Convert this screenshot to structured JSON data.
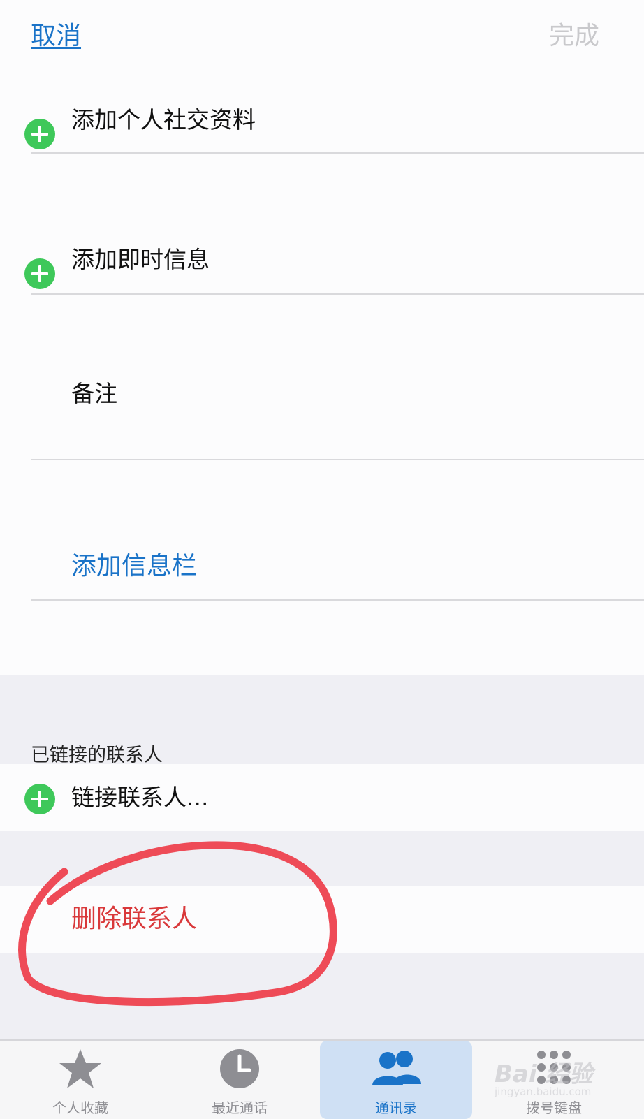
{
  "nav": {
    "cancel_label": "取消",
    "done_label": "完成"
  },
  "rows": {
    "add_social_profile": "添加个人社交资料",
    "add_instant_message": "添加即时信息",
    "notes": "备注",
    "add_field": "添加信息栏"
  },
  "linked_contacts": {
    "header": "已链接的联系人",
    "link_contact": "链接联系人..."
  },
  "delete_contact_label": "删除联系人",
  "tabs": [
    {
      "label": "个人收藏",
      "icon": "star-icon",
      "active": false
    },
    {
      "label": "最近通话",
      "icon": "clock-icon",
      "active": false
    },
    {
      "label": "通讯录",
      "icon": "contacts-icon",
      "active": true
    },
    {
      "label": "拨号键盘",
      "icon": "keypad-icon",
      "active": false
    }
  ],
  "watermark": {
    "text": "Bai 经验",
    "sub": "jingyan.baidu.com"
  },
  "colors": {
    "accent_blue": "#1a73c8",
    "plus_green": "#3ec85a",
    "delete_red": "#d9383a",
    "annotation_circle": "#ee4b57",
    "section_gray": "#efeff4"
  }
}
